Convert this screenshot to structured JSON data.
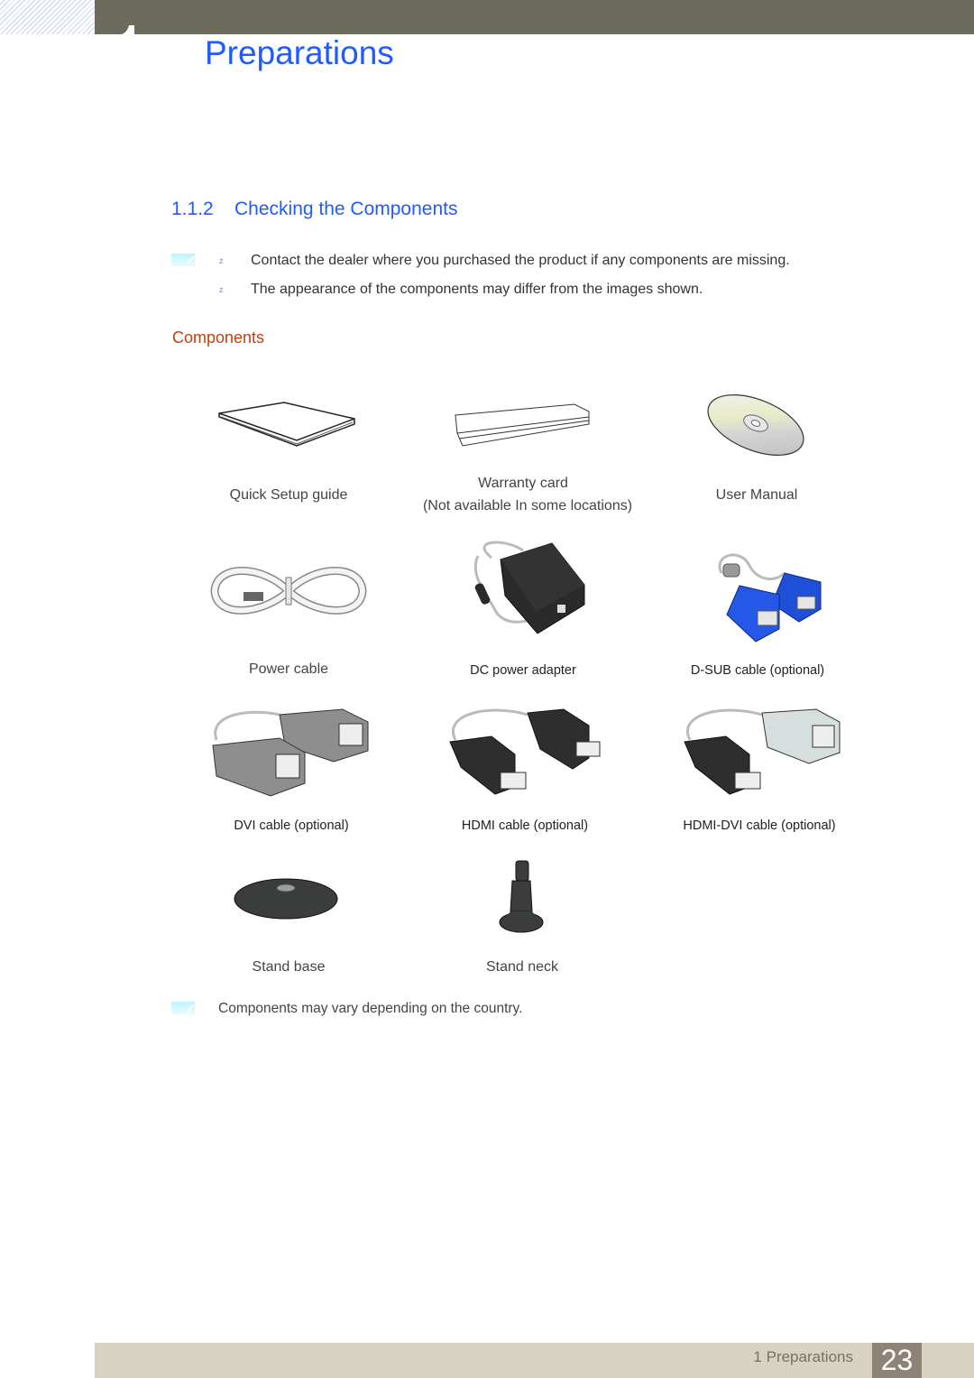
{
  "header": {
    "chapter_title": "Preparations"
  },
  "section": {
    "number": "1.1.2",
    "title": "Checking the Components"
  },
  "notes": {
    "bullet_marker": "z",
    "items": [
      "Contact the dealer where you purchased the product if any components are missing.",
      "The appearance of the components may differ from the images shown."
    ]
  },
  "components": {
    "heading": "Components",
    "items": [
      {
        "icon": "quick-setup-guide-booklet",
        "label": "Quick Setup guide"
      },
      {
        "icon": "warranty-card",
        "label": "Warranty card",
        "sublabel": "(Not available In some locations)"
      },
      {
        "icon": "cd-disc",
        "label": "User Manual"
      },
      {
        "icon": "power-cable",
        "label": "Power cable"
      },
      {
        "icon": "dc-power-adapter",
        "label": "DC power adapter"
      },
      {
        "icon": "dsub-cable",
        "label": "D-SUB cable (optional)"
      },
      {
        "icon": "dvi-cable",
        "label": "DVI cable (optional)"
      },
      {
        "icon": "hdmi-cable",
        "label": "HDMI cable (optional)"
      },
      {
        "icon": "hdmi-dvi-cable",
        "label": "HDMI-DVI cable (optional)"
      },
      {
        "icon": "stand-base",
        "label": "Stand base"
      },
      {
        "icon": "stand-neck",
        "label": "Stand neck"
      }
    ],
    "footnote": "Components may vary depending on the country."
  },
  "footer": {
    "chapter_label": "1 Preparations",
    "page_number": "23"
  },
  "colors": {
    "accent_blue": "#1f5bff",
    "subheading_orange": "#c2410c",
    "header_bar": "#6d6b5b",
    "footer_bar": "#d8d2c0",
    "page_number_bg": "#8d8377"
  }
}
